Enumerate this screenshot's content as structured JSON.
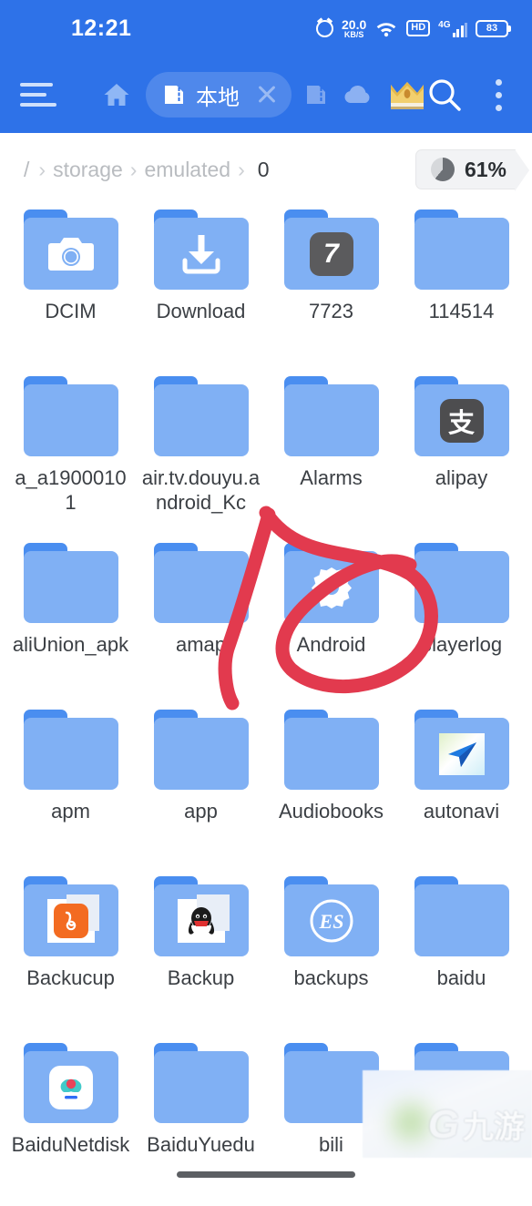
{
  "status_bar": {
    "time": "12:21",
    "net_speed_value": "20.0",
    "net_speed_unit": "KB/S",
    "hd_label": "HD",
    "network_type": "4G",
    "battery_level": "83",
    "icons": [
      "alarm-icon",
      "wifi-icon",
      "hd-icon",
      "signal-icon",
      "battery-icon"
    ]
  },
  "toolbar": {
    "menu_icon": "hamburger-menu-icon",
    "home_icon": "home-icon",
    "tab": {
      "icon": "sdcard-icon",
      "label": "本地",
      "close_icon": "close-icon"
    },
    "sdcard_icon": "sdcard-icon",
    "cloud_icon": "cloud-icon",
    "vip_icon": "crown-icon",
    "search_icon": "search-icon",
    "overflow_icon": "three-dot-menu-icon",
    "accent_color": "#2e72e8"
  },
  "path_bar": {
    "segments": [
      "/",
      "storage",
      "emulated",
      "0"
    ],
    "separator": "›",
    "storage_badge": {
      "icon": "pie-chart-icon",
      "percent_label": "61%",
      "percent_value": 61
    }
  },
  "grid": {
    "columns": 4,
    "folder_color": "#80b0f4",
    "folder_tab_color": "#4a8ef0",
    "items": [
      {
        "name": "DCIM",
        "glyph": "camera-icon"
      },
      {
        "name": "Download",
        "glyph": "download-icon"
      },
      {
        "name": "7723",
        "glyph": "app-7723-icon",
        "badge_text": "7"
      },
      {
        "name": "114514",
        "glyph": "none"
      },
      {
        "name": "a_a19000101",
        "glyph": "none"
      },
      {
        "name": "air.tv.douyu.android_Kc",
        "glyph": "none"
      },
      {
        "name": "Alarms",
        "glyph": "none"
      },
      {
        "name": "alipay",
        "glyph": "alipay-icon",
        "badge_text": "支"
      },
      {
        "name": "aliUnion_apk",
        "glyph": "none"
      },
      {
        "name": "amap",
        "glyph": "none"
      },
      {
        "name": "Android",
        "glyph": "gear-icon"
      },
      {
        "name": "playerlog",
        "glyph": "none"
      },
      {
        "name": "apm",
        "glyph": "none"
      },
      {
        "name": "app",
        "glyph": "none"
      },
      {
        "name": "Audiobooks",
        "glyph": "none"
      },
      {
        "name": "autonavi",
        "glyph": "autonavi-icon"
      },
      {
        "name": "Backucup",
        "glyph": "uc-browser-icon"
      },
      {
        "name": "Backup",
        "glyph": "qq-icon"
      },
      {
        "name": "backups",
        "glyph": "es-explorer-icon",
        "badge_text": "ES"
      },
      {
        "name": "baidu",
        "glyph": "none"
      },
      {
        "name": "BaiduNetdisk",
        "glyph": "baidu-netdisk-icon"
      },
      {
        "name": "BaiduYuedu",
        "glyph": "none"
      },
      {
        "name": "bili",
        "glyph": "none"
      },
      {
        "name": "",
        "glyph": "none"
      }
    ]
  },
  "annotation": {
    "type": "hand-drawn-circle-with-slash",
    "color": "#e23a4e",
    "targets": "Android"
  },
  "watermark": {
    "logo_text": "G",
    "text": "九游"
  }
}
